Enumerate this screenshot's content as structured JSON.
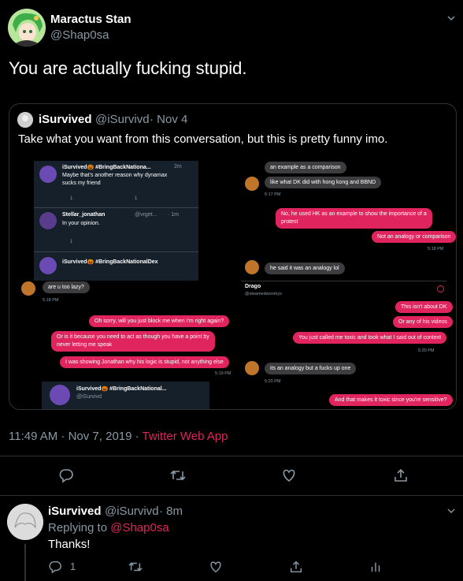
{
  "tweet": {
    "author_name": "Maractus Stan",
    "author_handle": "@Shap0sa",
    "text": "You are actually fucking stupid.",
    "timestamp": "11:49 AM · Nov 7, 2019",
    "client": "Twitter Web App",
    "separator": " · "
  },
  "quoted": {
    "author_name": "iSurvived",
    "author_handle": "@iSurvivd",
    "date": "· Nov 4",
    "text": "Take what you want from this conversation, but this is pretty funny imo."
  },
  "embedded": {
    "left_panel": {
      "t1_name": "iSurvived🎃 #BringBackNationa...",
      "t1_time": "2m",
      "t1_text_1": "Maybe that's another reason why dynamax",
      "t1_text_2": "sucks my friend",
      "t1_count_1": "1",
      "t1_count_2": "1",
      "t2_name": "Stellar_jonathan",
      "t2_handle": "@vrget...",
      "t2_time": "· 1m",
      "t2_text": "In your opinion.",
      "t2_count": "1",
      "t3_name": "iSurvived🎃 #BringBackNationalDex"
    },
    "left_chat": {
      "b1": "are u too lazy?",
      "ts1": "5:18 PM",
      "b2": "Oh sorry, will you just block me when I'm right again?",
      "b3a": "Or is it because you need to act as though you have a point by",
      "b3b": "never letting me speak",
      "b4": "I was showing Jonathan why his logic is stupid, not anything else",
      "ts2": "5:19 PM"
    },
    "bottom_card": {
      "name": "iSurvived🎃 #BringBackNational...",
      "handle": "@iSurvivd"
    },
    "right_chat_top": {
      "b1": "an example as a comparison",
      "b2": "like what DK did with hong kong and BBND",
      "ts1": "5:17 PM",
      "b3a": "No, he used HK as an example to show the importance of a",
      "b3b": "protest",
      "b4": "Not an analogy or comparison",
      "ts2": "5:18 PM",
      "b5": "he said it was an analogy lol"
    },
    "right_chat_bottom": {
      "contact_name": "Drago",
      "contact_handle": "@steamedwoomys",
      "b1": "This isn't about DK",
      "b2": "Or any of his videos",
      "b3": "You just called me toxic and took what I said out of context",
      "ts1": "5:20 PM",
      "b4": "its an analogy but a fucks up one",
      "ts2": "5:20 PM",
      "b5": "And that makes it toxic since you're sensitive?"
    }
  },
  "reply": {
    "author_name": "iSurvived",
    "author_handle": "@iSurvivd",
    "time": "· 8m",
    "replying_prefix": "Replying to ",
    "replying_to": "@Shap0sa",
    "text": "Thanks!",
    "reply_count": "1"
  },
  "colors": {
    "background": "#000000",
    "accent": "#e0245e",
    "muted": "#8899a6",
    "divider": "#2f3336"
  },
  "icons": [
    "reply-icon",
    "retweet-icon",
    "like-icon",
    "share-icon",
    "analytics-icon",
    "chevron-down-icon"
  ]
}
